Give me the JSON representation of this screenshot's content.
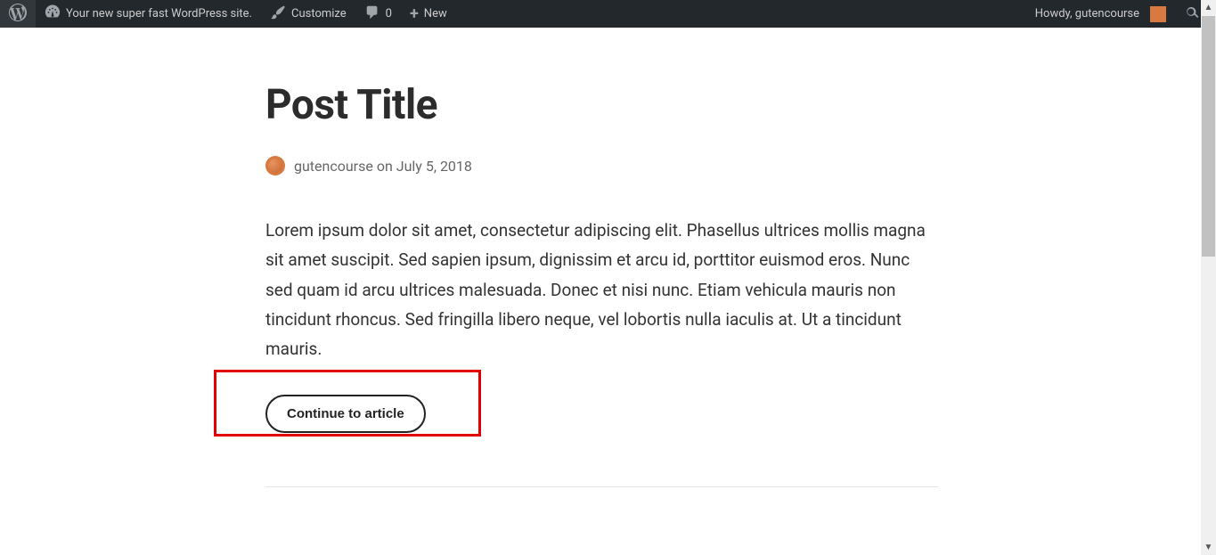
{
  "adminBar": {
    "siteName": "Your new super fast WordPress site.",
    "customize": "Customize",
    "commentCount": "0",
    "newLabel": "New",
    "howdy": "Howdy, gutencourse"
  },
  "post": {
    "title": "Post Title",
    "author": "gutencourse",
    "dateConnector": "on",
    "date": "July 5, 2018",
    "excerpt": "Lorem ipsum dolor sit amet, consectetur adipiscing elit. Phasellus ultrices mollis magna sit amet suscipit. Sed sapien ipsum, dignissim et arcu id, porttitor euismod eros. Nunc sed quam id arcu ultrices malesuada. Donec et nisi nunc. Etiam vehicula mauris non tincidunt rhoncus. Sed fringilla libero neque, vel lobortis nulla iaculis at. Ut a tincidunt mauris.",
    "continueLabel": "Continue to article"
  }
}
